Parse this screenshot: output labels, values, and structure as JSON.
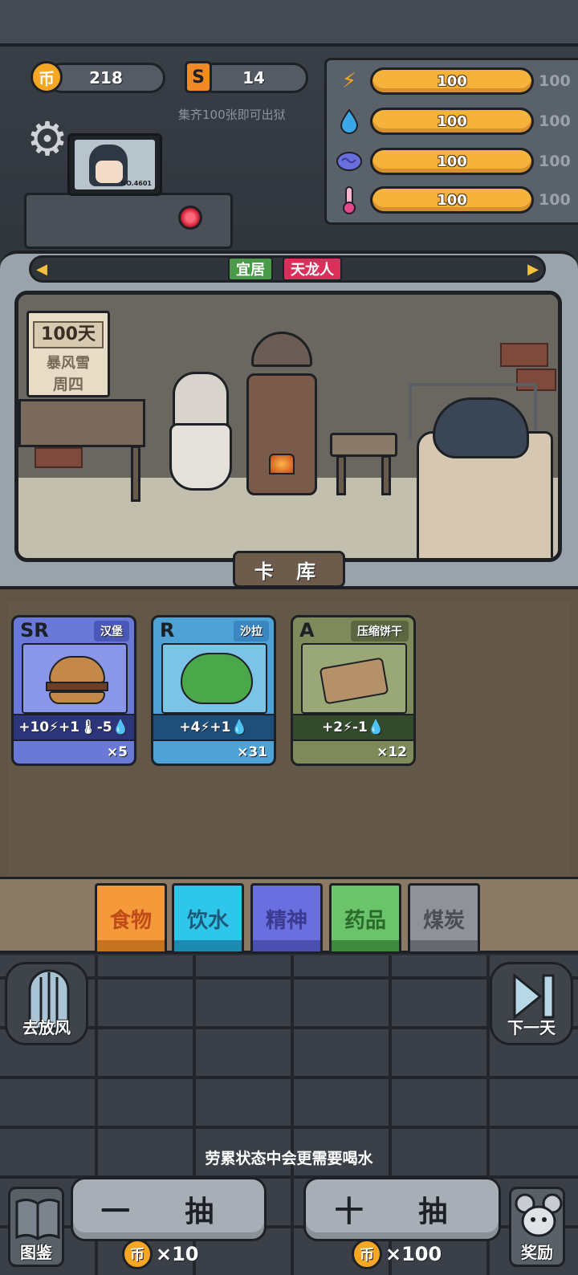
{
  "currency": {
    "coin_icon": "币",
    "coins": "218",
    "ticket_icon": "S",
    "tickets": "14",
    "hint": "集齐100张即可出狱"
  },
  "stats": [
    {
      "icon": "energy-icon",
      "glyph": "⚡",
      "color": "#f5a623",
      "value": "100",
      "max": "100",
      "fill": 1.0
    },
    {
      "icon": "water-icon",
      "glyph": "💧",
      "color": "#3aa7e8",
      "value": "100",
      "max": "100",
      "fill": 1.0
    },
    {
      "icon": "brain-icon",
      "glyph": "🧠",
      "color": "#6a6fe0",
      "value": "100",
      "max": "100",
      "fill": 1.0
    },
    {
      "icon": "thermometer-icon",
      "glyph": "🌡",
      "color": "#e8488a",
      "value": "100",
      "max": "100",
      "fill": 1.0
    }
  ],
  "monitor": {
    "id": "NO.4601"
  },
  "room": {
    "tags": [
      {
        "label": "宜居",
        "color": "#4a9a4a"
      },
      {
        "label": "天龙人",
        "color": "#d8305a"
      }
    ],
    "calendar": {
      "days": "100天",
      "weather": "暴风雪",
      "weekday": "周四"
    }
  },
  "card_library_label": "卡 库",
  "cards": [
    {
      "rarity": "SR",
      "name": "汉堡",
      "effect": "+10⚡+1🌡-5💧",
      "count": "×5",
      "bg": "#6a78d8",
      "name_bg": "#4a58b8",
      "effect_bg": "#2c357a",
      "art_bg": "#8a96e8"
    },
    {
      "rarity": "R",
      "name": "沙拉",
      "effect": "+4⚡+1💧",
      "count": "×31",
      "bg": "#4fa2d6",
      "name_bg": "#3a86c0",
      "effect_bg": "#1e4f7a",
      "art_bg": "#7cc3e8"
    },
    {
      "rarity": "A",
      "name": "压缩饼干",
      "effect": "+2⚡-1💧",
      "count": "×12",
      "bg": "#7f8a5a",
      "name_bg": "#5c6640",
      "effect_bg": "#344a2c",
      "art_bg": "#9aa878"
    }
  ],
  "categories": [
    {
      "label": "食物",
      "bg": "#f49a3a",
      "text": "#c04a18",
      "bottom": "#c4741f"
    },
    {
      "label": "饮水",
      "bg": "#2fc6ec",
      "text": "#1d5a7a",
      "bottom": "#1e8ab0"
    },
    {
      "label": "精神",
      "bg": "#6a6fe0",
      "text": "#3a3a90",
      "bottom": "#4a4fb0"
    },
    {
      "label": "药品",
      "bg": "#6cc46a",
      "text": "#2a6a2a",
      "bottom": "#3e8a3e"
    },
    {
      "label": "煤炭",
      "bg": "#8f9399",
      "text": "#4a4e54",
      "bottom": "#65696f"
    }
  ],
  "side_buttons": {
    "left": "去放风",
    "right": "下一天"
  },
  "hint_bottom": "劳累状态中会更需要喝水",
  "draw": {
    "single": {
      "label": "一 抽",
      "cost": "×10"
    },
    "ten": {
      "label": "十 抽",
      "cost": "×100"
    }
  },
  "corner": {
    "left": "图鉴",
    "right": "奖励"
  }
}
